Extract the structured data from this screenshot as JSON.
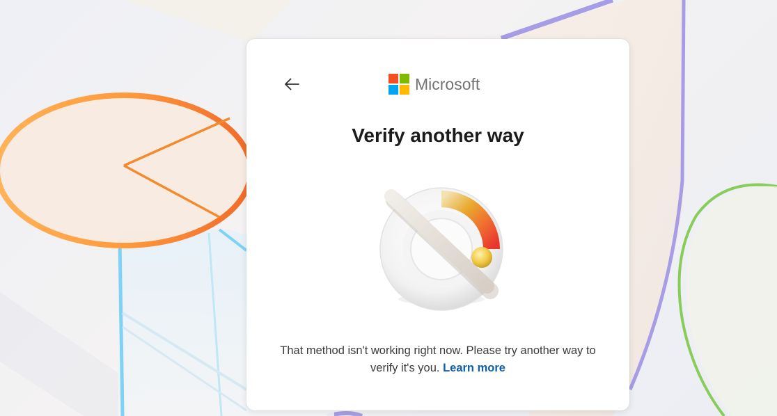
{
  "brand": {
    "name": "Microsoft",
    "logo_colors": [
      "#f25022",
      "#7fba00",
      "#00a4ef",
      "#ffb900"
    ]
  },
  "back_button": {
    "icon": "arrow-left-icon",
    "aria_label": "Back"
  },
  "page": {
    "title": "Verify another way",
    "message": "That method isn't working right now. Please try another way to verify it's you.",
    "learn_more": "Learn more"
  },
  "illustration": {
    "icon": "gauge-meter-icon"
  },
  "colors": {
    "link": "#0f5fa8",
    "title": "#1b1b1b",
    "body_text": "#3b3b3b"
  }
}
